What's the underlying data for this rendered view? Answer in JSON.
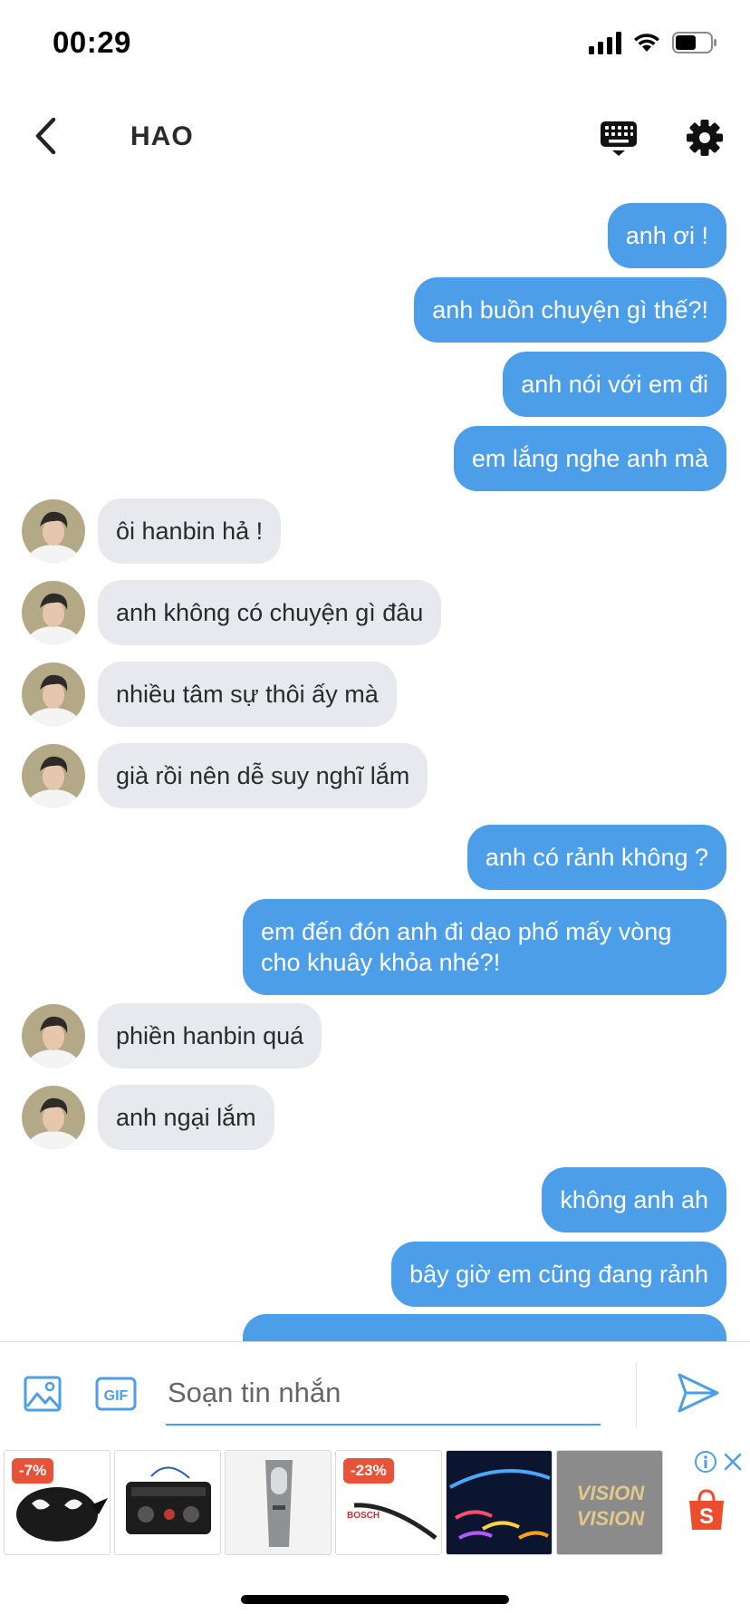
{
  "status_bar": {
    "time": "00:29"
  },
  "header": {
    "back_icon": "chevron-left-icon",
    "contact_name": "HAO",
    "keyboard_icon": "keyboard-icon",
    "settings_icon": "gear-icon"
  },
  "messages": [
    {
      "direction": "out",
      "text": "anh ơi !"
    },
    {
      "direction": "out",
      "text": "anh buồn chuyện gì thế?!"
    },
    {
      "direction": "out",
      "text": "anh nói với em đi"
    },
    {
      "direction": "out",
      "text": "em lắng nghe anh mà"
    },
    {
      "direction": "in",
      "text": "ôi hanbin hả !"
    },
    {
      "direction": "in",
      "text": "anh không có chuyện gì đâu"
    },
    {
      "direction": "in",
      "text": "nhiều tâm sự thôi ấy mà"
    },
    {
      "direction": "in",
      "text": "già rồi nên dễ suy nghĩ lắm"
    },
    {
      "direction": "out",
      "text": "anh có rảnh không ?"
    },
    {
      "direction": "out",
      "text": "em đến đón anh đi dạo phố mấy vòng cho khuây khỏa nhé?!"
    },
    {
      "direction": "in",
      "text": "phiền hanbin quá"
    },
    {
      "direction": "in",
      "text": "anh ngại lắm"
    },
    {
      "direction": "out",
      "text": "không anh ah"
    },
    {
      "direction": "out",
      "text": "bây giờ em cũng đang rảnh"
    }
  ],
  "composer": {
    "placeholder": "Soạn tin nhắn",
    "image_icon": "image-icon",
    "gif_icon": "gif-icon",
    "gif_label": "GIF",
    "send_icon": "send-icon"
  },
  "ads": {
    "items": [
      {
        "discount": "-7%"
      },
      {
        "discount": ""
      },
      {
        "discount": ""
      },
      {
        "discount": "-23%"
      },
      {
        "discount": ""
      },
      {
        "discount": ""
      }
    ],
    "info_icon": "info-icon",
    "close_icon": "close-icon",
    "shop_icon": "shopee-bag-icon",
    "shop_letter": "S",
    "product_text_bosch": "BOSCH",
    "product_text_vision": "VISION"
  },
  "colors": {
    "accent": "#4d9ee9",
    "incoming_bubble": "#e8e9ee",
    "discount": "#e8523a"
  }
}
